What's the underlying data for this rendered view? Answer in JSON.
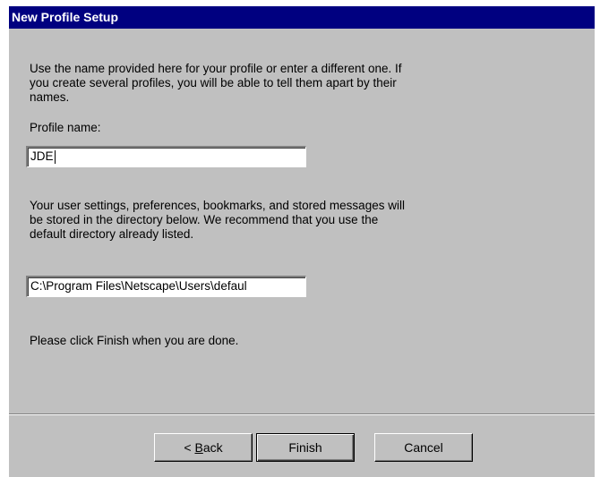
{
  "dialog": {
    "title": "New Profile Setup",
    "intro_line1": "Use the name provided here for your profile or enter a different one.  If",
    "intro_line2": "you create several profiles, you will be able to tell them apart by their",
    "intro_line3": "names.",
    "profile_name_label": "Profile name:",
    "profile_name_value": "JDE",
    "dir_line1": "Your user settings, preferences, bookmarks, and stored messages will",
    "dir_line2": "be stored in the directory below.  We recommend that you use the",
    "dir_line3": "default directory already listed.",
    "directory_value": "C:\\Program Files\\Netscape\\Users\\defaul",
    "finish_hint": "Please click Finish when you are done."
  },
  "buttons": {
    "back_prefix": "< ",
    "back_accel": "B",
    "back_rest": "ack",
    "finish": "Finish",
    "cancel": "Cancel"
  }
}
